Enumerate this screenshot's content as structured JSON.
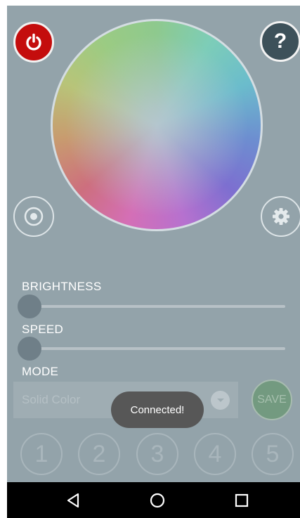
{
  "colors": {
    "background": "#93a3aa",
    "power": "#c40d0d",
    "help": "#3d515a",
    "save": "#739a80",
    "toast": "#575757",
    "nav_bar": "#000000"
  },
  "top_bar": {
    "power_icon": "power-icon",
    "help_label": "?"
  },
  "color_wheel": {
    "icon": "color-wheel"
  },
  "side_buttons": {
    "left_icon": "target-icon",
    "right_icon": "gear-icon"
  },
  "brightness": {
    "label": "BRIGHTNESS",
    "value_fraction": 0.0
  },
  "speed": {
    "label": "SPEED",
    "value_fraction": 0.0
  },
  "mode": {
    "label": "MODE",
    "selected": "Solid Color",
    "dropdown_icon": "chevron-down-icon"
  },
  "save_label": "SAVE",
  "presets": [
    "1",
    "2",
    "3",
    "4",
    "5"
  ],
  "toast_text": "Connected!",
  "nav": {
    "back_icon": "back-icon",
    "home_icon": "home-icon",
    "recents_icon": "recents-icon"
  }
}
